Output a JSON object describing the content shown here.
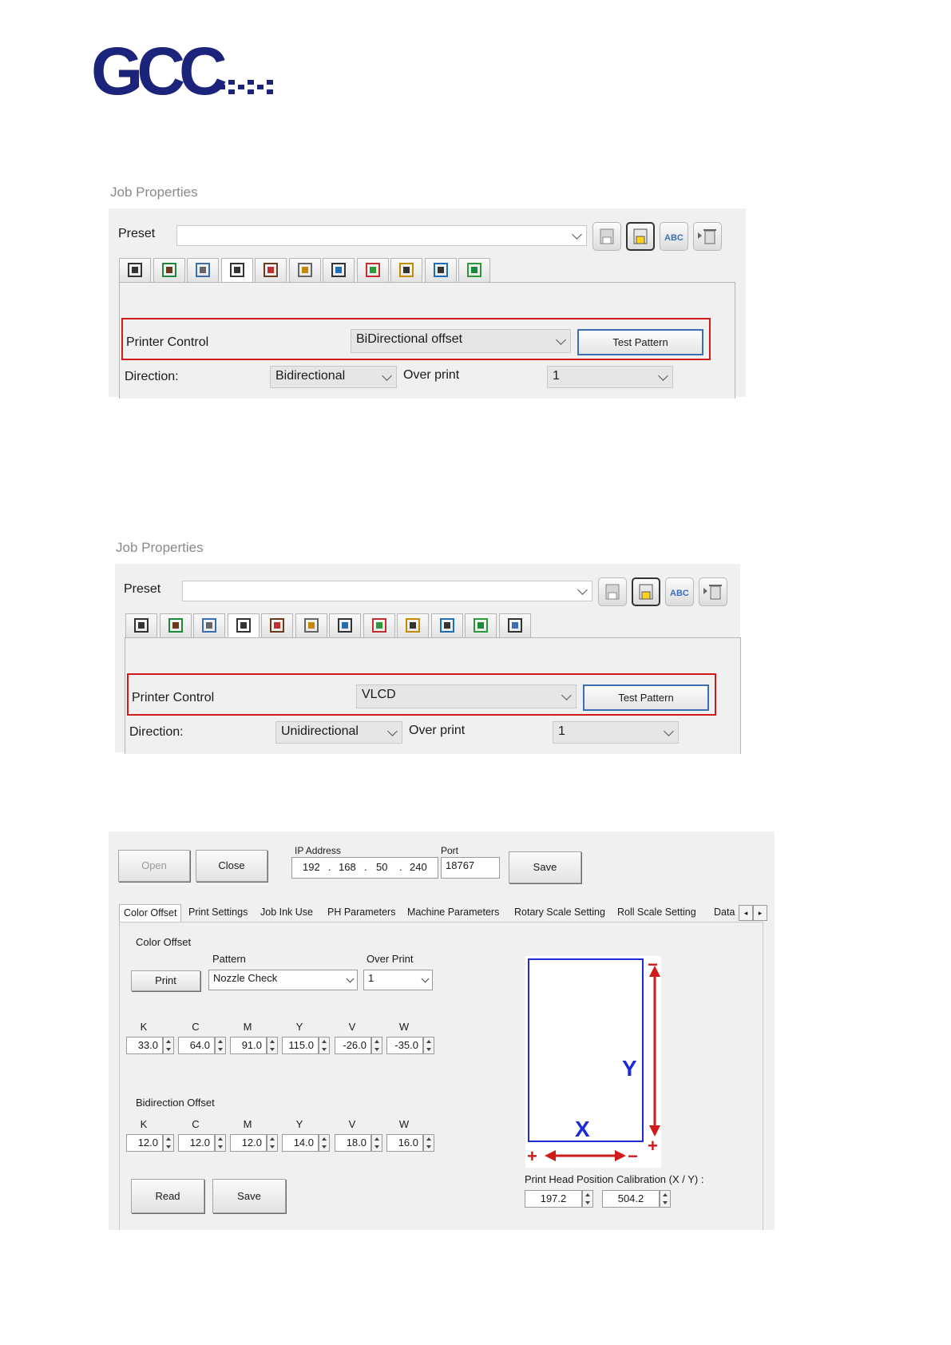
{
  "logo": {
    "text": "GCC"
  },
  "panel1": {
    "title": "Job Properties",
    "preset_label": "Preset",
    "preset_value": "",
    "toolbar_icons": [
      "save-icon",
      "save-as-icon",
      "rename-icon",
      "delete-icon"
    ],
    "tab_icons": [
      "layout-icon",
      "import-icon",
      "color-icon",
      "printer-control-icon",
      "tile-icon",
      "position-icon",
      "color-bar-icon",
      "layers-icon",
      "ink-icon",
      "white-ink-icon",
      "edit-color-icon"
    ],
    "printer_control_label": "Printer Control",
    "printer_control_value": "BiDirectional offset",
    "test_pattern": "Test Pattern",
    "direction_label": "Direction:",
    "direction_value": "Bidirectional",
    "overprint_label": "Over print",
    "overprint_value": "1"
  },
  "panel2": {
    "title": "Job Properties",
    "preset_label": "Preset",
    "preset_value": "",
    "toolbar_icons": [
      "save-icon",
      "save-as-icon",
      "rename-icon",
      "delete-icon"
    ],
    "tab_icons": [
      "layout-icon",
      "import-icon",
      "color-icon",
      "printer-control-icon",
      "head-icon",
      "tile-icon",
      "position-icon",
      "color-bar-icon",
      "layers-icon",
      "ink-icon",
      "white-ink-icon",
      "edit-color-icon"
    ],
    "printer_control_label": "Printer Control",
    "printer_control_value": "VLCD",
    "test_pattern": "Test Pattern",
    "direction_label": "Direction:",
    "direction_value": "Unidirectional",
    "overprint_label": "Over print",
    "overprint_value": "1"
  },
  "panel3": {
    "open": "Open",
    "close": "Close",
    "ip_label": "IP Address",
    "ip": [
      "192",
      "168",
      "50",
      "240"
    ],
    "ip_dot": ".",
    "port_label": "Port",
    "port": "18767",
    "save_top": "Save",
    "tabs": [
      "Color Offset",
      "Print Settings",
      "Job Ink Use",
      "PH Parameters",
      "Machine Parameters",
      "Rotary Scale Setting",
      "Roll Scale Setting",
      "Data"
    ],
    "color_offset_title": "Color Offset",
    "pattern_label": "Pattern",
    "overprint_label": "Over Print",
    "print_button": "Print",
    "pattern_value": "Nozzle Check",
    "overprint_value": "1",
    "channels": [
      "K",
      "C",
      "M",
      "Y",
      "V",
      "W"
    ],
    "color_offsets": [
      "33.0",
      "64.0",
      "91.0",
      "115.0",
      "-26.0",
      "-35.0"
    ],
    "bidirection_title": "Bidirection Offset",
    "bidirection_offsets": [
      "12.0",
      "12.0",
      "12.0",
      "14.0",
      "18.0",
      "16.0"
    ],
    "read_button": "Read",
    "save_bottom": "Save",
    "diagram": {
      "y_label": "Y",
      "x_label": "X",
      "minus": "−",
      "plus": "+"
    },
    "calibration_label": "Print Head Position Calibration (X / Y) :",
    "calibration_x": "197.2",
    "calibration_y": "504.2"
  },
  "colors": {
    "highlight": "#d11a1a",
    "diagram_blue": "#1d2bd6",
    "diagram_red": "#d11a1a",
    "logo_navy": "#1b237a"
  }
}
